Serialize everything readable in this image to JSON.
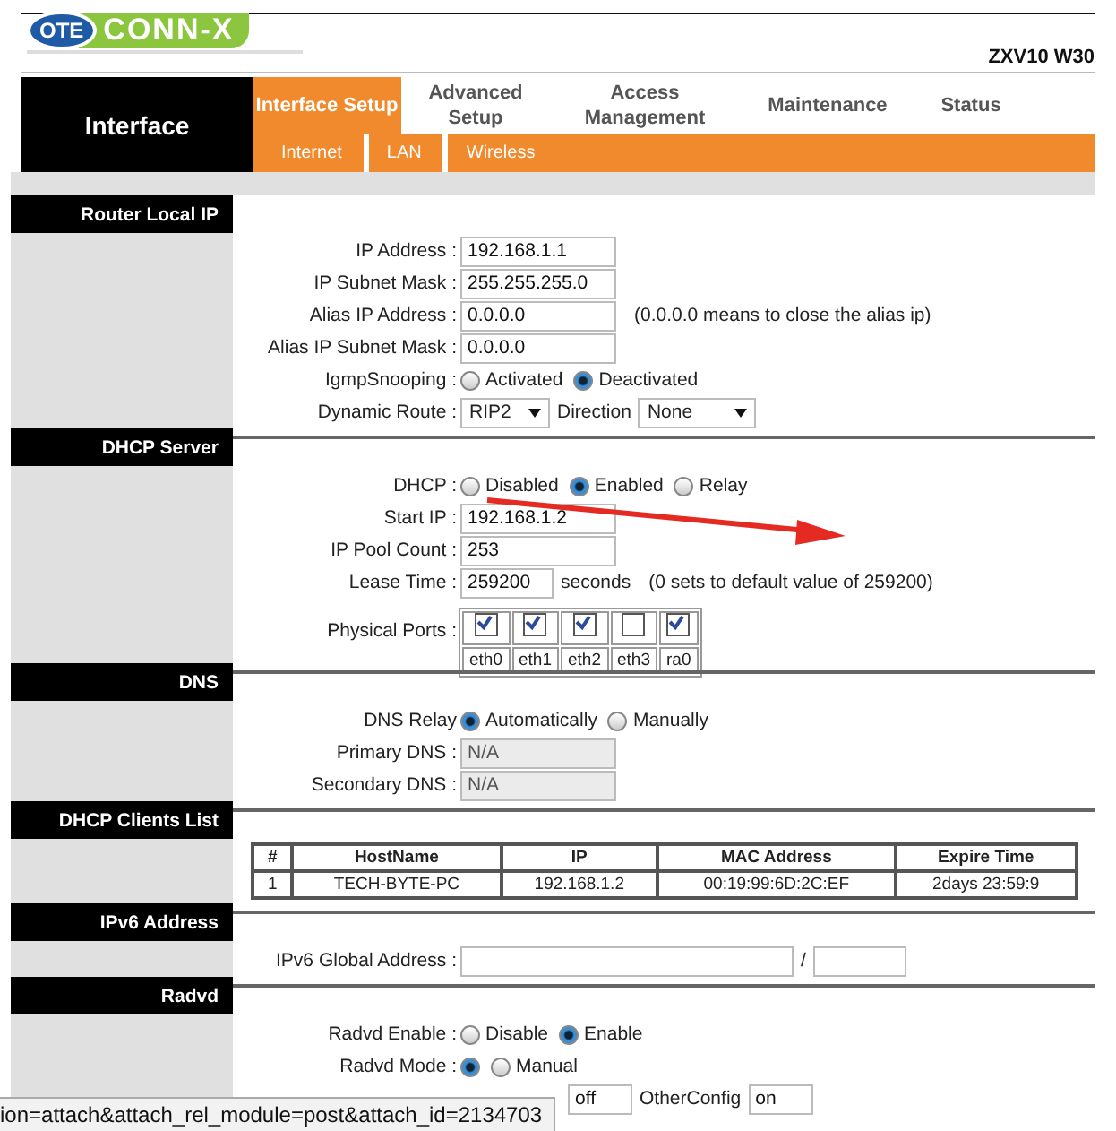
{
  "header": {
    "logo": {
      "badge": "OTE",
      "name": "CONN-X"
    },
    "model": "ZXV10 W30"
  },
  "nav": {
    "section": "Interface",
    "tabs": [
      {
        "label": "Interface Setup",
        "selected": true
      },
      {
        "label": "Advanced Setup",
        "selected": false
      },
      {
        "label": "Access Management",
        "selected": false
      },
      {
        "label": "Maintenance",
        "selected": false
      },
      {
        "label": "Status",
        "selected": false
      }
    ],
    "subtabs": [
      "Internet",
      "LAN",
      "Wireless"
    ]
  },
  "sections": [
    {
      "title": "Router Local IP",
      "rows": [
        {
          "label": "IP Address :",
          "items": [
            {
              "kind": "field",
              "value": "192.168.1.1"
            }
          ]
        },
        {
          "label": "IP Subnet Mask :",
          "items": [
            {
              "kind": "field",
              "value": "255.255.255.0"
            }
          ]
        },
        {
          "label": "Alias IP Address :",
          "items": [
            {
              "kind": "field",
              "value": "0.0.0.0"
            },
            {
              "kind": "note",
              "text": "(0.0.0.0 means to close the alias ip)"
            }
          ]
        },
        {
          "label": "Alias IP Subnet Mask :",
          "items": [
            {
              "kind": "field",
              "value": "0.0.0.0"
            }
          ]
        },
        {
          "label": "IgmpSnooping :",
          "items": [
            {
              "kind": "radio",
              "text": "Activated",
              "selected": false
            },
            {
              "kind": "radio",
              "text": "Deactivated",
              "selected": true
            }
          ]
        },
        {
          "label": "Dynamic Route :",
          "items": [
            {
              "kind": "select",
              "value": "RIP2"
            },
            {
              "kind": "text",
              "text": "Direction"
            },
            {
              "kind": "wide-select",
              "value": "None"
            }
          ]
        }
      ]
    },
    {
      "title": "DHCP Server",
      "rows": [
        {
          "label": "DHCP :",
          "items": [
            {
              "kind": "radio",
              "text": "Disabled",
              "selected": false
            },
            {
              "kind": "radio",
              "text": "Enabled",
              "selected": true
            },
            {
              "kind": "radio",
              "text": "Relay",
              "selected": false
            }
          ]
        },
        {
          "label": "Start IP :",
          "items": [
            {
              "kind": "field",
              "value": "192.168.1.2"
            }
          ]
        },
        {
          "label": "IP Pool Count :",
          "items": [
            {
              "kind": "field",
              "value": "253"
            }
          ]
        },
        {
          "label": "Lease Time :",
          "items": [
            {
              "kind": "short-field",
              "value": "259200"
            },
            {
              "kind": "text",
              "text": "seconds"
            },
            {
              "kind": "note",
              "text": "(0 sets to default value of 259200)"
            }
          ]
        },
        {
          "label": "Physical Ports :",
          "items": [
            {
              "kind": "ports",
              "ports": [
                {
                  "label": "eth0",
                  "checked": true
                },
                {
                  "label": "eth1",
                  "checked": true
                },
                {
                  "label": "eth2",
                  "checked": true
                },
                {
                  "label": "eth3",
                  "checked": false
                },
                {
                  "label": "ra0",
                  "checked": true
                }
              ]
            }
          ]
        }
      ]
    },
    {
      "title": "DNS",
      "rows": [
        {
          "label": "DNS Relay",
          "items": [
            {
              "kind": "radio",
              "text": "Automatically",
              "selected": true
            },
            {
              "kind": "radio",
              "text": "Manually",
              "selected": false
            }
          ]
        },
        {
          "label": "Primary DNS :",
          "items": [
            {
              "kind": "field",
              "value": "N/A",
              "disabled": true
            }
          ]
        },
        {
          "label": "Secondary DNS :",
          "items": [
            {
              "kind": "field",
              "value": "N/A",
              "disabled": true
            }
          ]
        }
      ]
    },
    {
      "title": "DHCP Clients List",
      "table": {
        "columns": [
          "#",
          "HostName",
          "IP",
          "MAC Address",
          "Expire Time"
        ],
        "rows": [
          [
            "1",
            "TECH-BYTE-PC",
            "192.168.1.2",
            "00:19:99:6D:2C:EF",
            "2days 23:59:9"
          ]
        ]
      }
    },
    {
      "title": "IPv6 Address",
      "rows": [
        {
          "label": "IPv6 Global Address :",
          "items": [
            {
              "kind": "long-field",
              "value": ""
            },
            {
              "kind": "text",
              "text": "/"
            },
            {
              "kind": "short-field",
              "value": ""
            }
          ]
        }
      ]
    },
    {
      "title": "Radvd",
      "rows": [
        {
          "label": "Radvd Enable :",
          "items": [
            {
              "kind": "radio",
              "text": "Disable",
              "selected": false
            },
            {
              "kind": "radio",
              "text": "Enable",
              "selected": true
            }
          ]
        },
        {
          "label": "Radvd Mode :",
          "items": [
            {
              "kind": "radio",
              "selected": true
            },
            {
              "kind": "radio",
              "text": "Manual",
              "selected": false
            }
          ]
        },
        {
          "items": [
            {
              "kind": "tiny-field",
              "value": "off"
            },
            {
              "kind": "text",
              "text": "OtherConfig"
            },
            {
              "kind": "tiny-field",
              "value": "on"
            }
          ]
        }
      ]
    }
  ],
  "status_bar": "ion=attach&attach_rel_module=post&attach_id=2134703"
}
